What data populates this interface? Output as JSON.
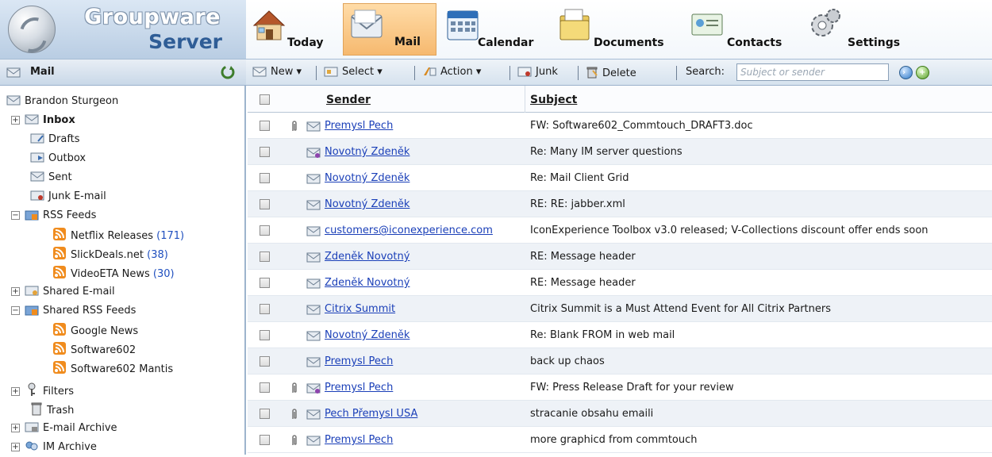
{
  "app": {
    "logo_line1": "Groupware",
    "logo_line2": "Server"
  },
  "nav": {
    "today": "Today",
    "mail": "Mail",
    "calendar": "Calendar",
    "documents": "Documents",
    "contacts": "Contacts",
    "settings": "Settings",
    "active": "Mail"
  },
  "leftbar": {
    "title": "Mail"
  },
  "toolbar": {
    "new": "New",
    "select": "Select",
    "action": "Action",
    "junk": "Junk",
    "delete": "Delete",
    "search_label": "Search:",
    "search_placeholder": "Subject or sender"
  },
  "tree": {
    "account": "Brandon Sturgeon",
    "inbox": "Inbox",
    "drafts": "Drafts",
    "outbox": "Outbox",
    "sent": "Sent",
    "junk": "Junk E-mail",
    "rss": "RSS Feeds",
    "netflix": "Netflix Releases",
    "netflix_count": "(171)",
    "slickdeals": "SlickDeals.net",
    "slickdeals_count": "(38)",
    "videoeta": "VideoETA News",
    "videoeta_count": "(30)",
    "shared_email": "Shared E-mail",
    "shared_rss": "Shared RSS Feeds",
    "google_news": "Google News",
    "software602": "Software602",
    "software602_mantis": "Software602 Mantis",
    "filters": "Filters",
    "trash": "Trash",
    "email_archive": "E-mail Archive",
    "im_archive": "IM Archive"
  },
  "grid": {
    "col_sender": "Sender",
    "col_subject": "Subject",
    "rows": [
      {
        "sender": "Premysl Pech",
        "subject": "FW: Software602_Commtouch_DRAFT3.doc"
      },
      {
        "sender": "Novotný Zdeněk",
        "subject": "Re: Many IM server questions"
      },
      {
        "sender": "Novotný Zdeněk",
        "subject": "Re: Mail Client Grid"
      },
      {
        "sender": "Novotný Zdeněk",
        "subject": "RE: RE: jabber.xml"
      },
      {
        "sender": "customers@iconexperience.com",
        "subject": "IconExperience Toolbox v3.0 released; V-Collections discount offer ends soon"
      },
      {
        "sender": "Zdeněk Novotný",
        "subject": "RE: Message header"
      },
      {
        "sender": "Zdeněk Novotný",
        "subject": "RE: Message header"
      },
      {
        "sender": "Citrix Summit",
        "subject": "Citrix Summit is a Must Attend Event for All Citrix Partners"
      },
      {
        "sender": "Novotný Zdeněk",
        "subject": "Re: Blank FROM in web mail"
      },
      {
        "sender": "Premysl Pech",
        "subject": "back up chaos"
      },
      {
        "sender": "Premysl Pech",
        "subject": "FW: Press Release Draft for your review"
      },
      {
        "sender": "Pech Přemysl USA",
        "subject": "stracanie obsahu emaili"
      },
      {
        "sender": "Premysl Pech",
        "subject": "more graphicd from commtouch"
      }
    ]
  }
}
